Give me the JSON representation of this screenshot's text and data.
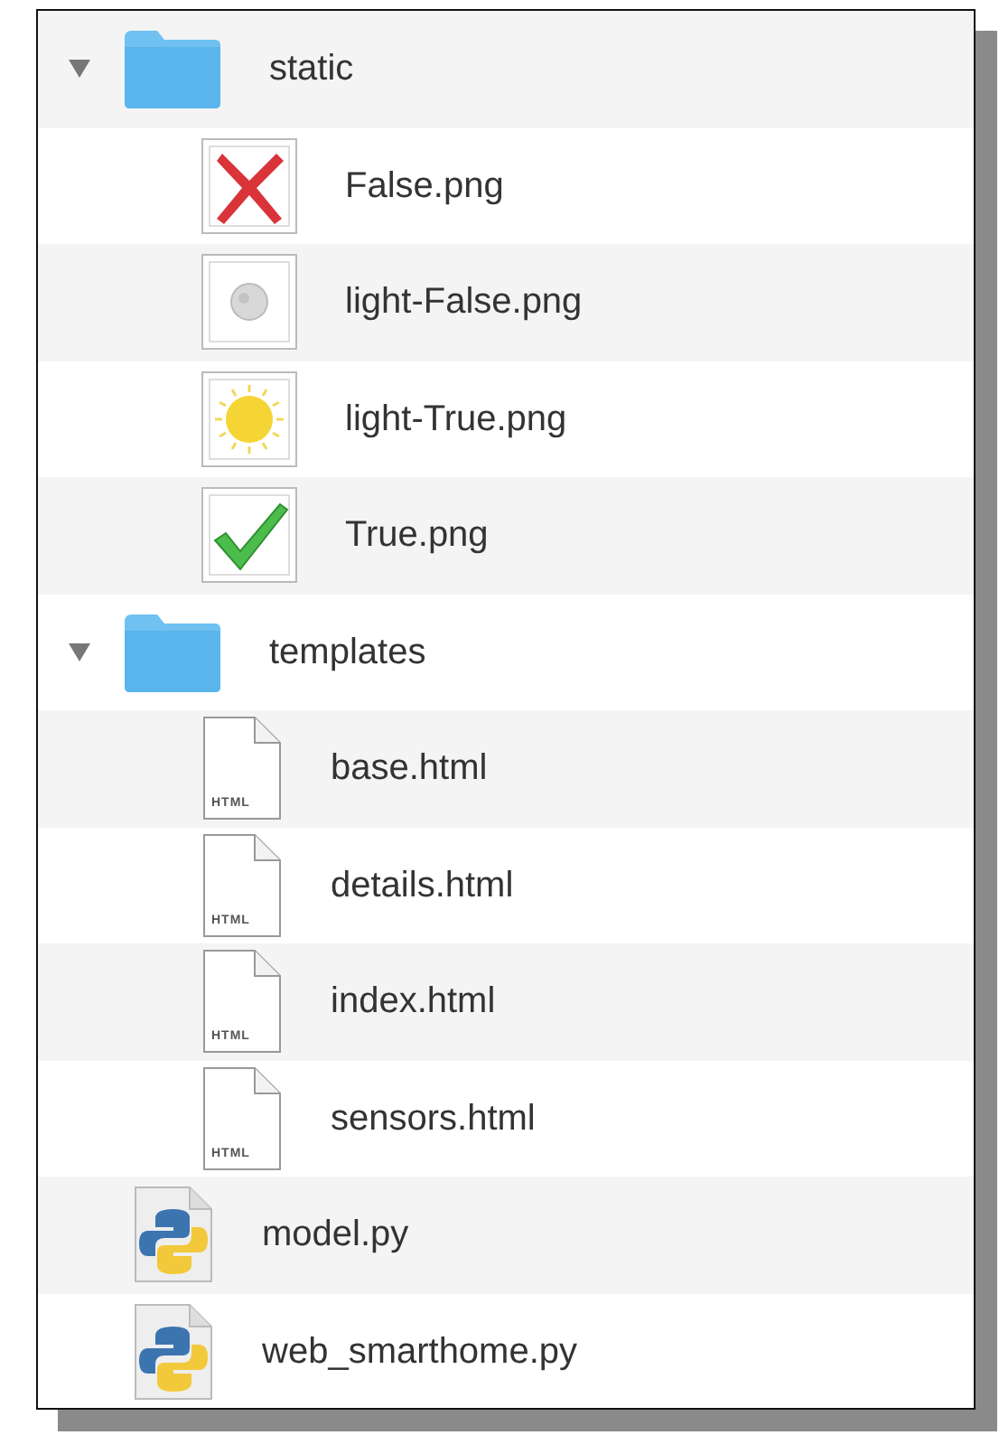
{
  "tree": [
    {
      "kind": "folder",
      "name": "static",
      "expanded": true,
      "children": [
        {
          "kind": "cross",
          "name": "False.png"
        },
        {
          "kind": "moon",
          "name": "light-False.png"
        },
        {
          "kind": "sun",
          "name": "light-True.png"
        },
        {
          "kind": "check",
          "name": "True.png"
        }
      ]
    },
    {
      "kind": "folder",
      "name": "templates",
      "expanded": true,
      "children": [
        {
          "kind": "html",
          "name": "base.html",
          "icon_label": "HTML"
        },
        {
          "kind": "html",
          "name": "details.html",
          "icon_label": "HTML"
        },
        {
          "kind": "html",
          "name": "index.html",
          "icon_label": "HTML"
        },
        {
          "kind": "html",
          "name": "sensors.html",
          "icon_label": "HTML"
        }
      ]
    },
    {
      "kind": "python",
      "name": "model.py"
    },
    {
      "kind": "python",
      "name": "web_smarthome.py"
    }
  ]
}
